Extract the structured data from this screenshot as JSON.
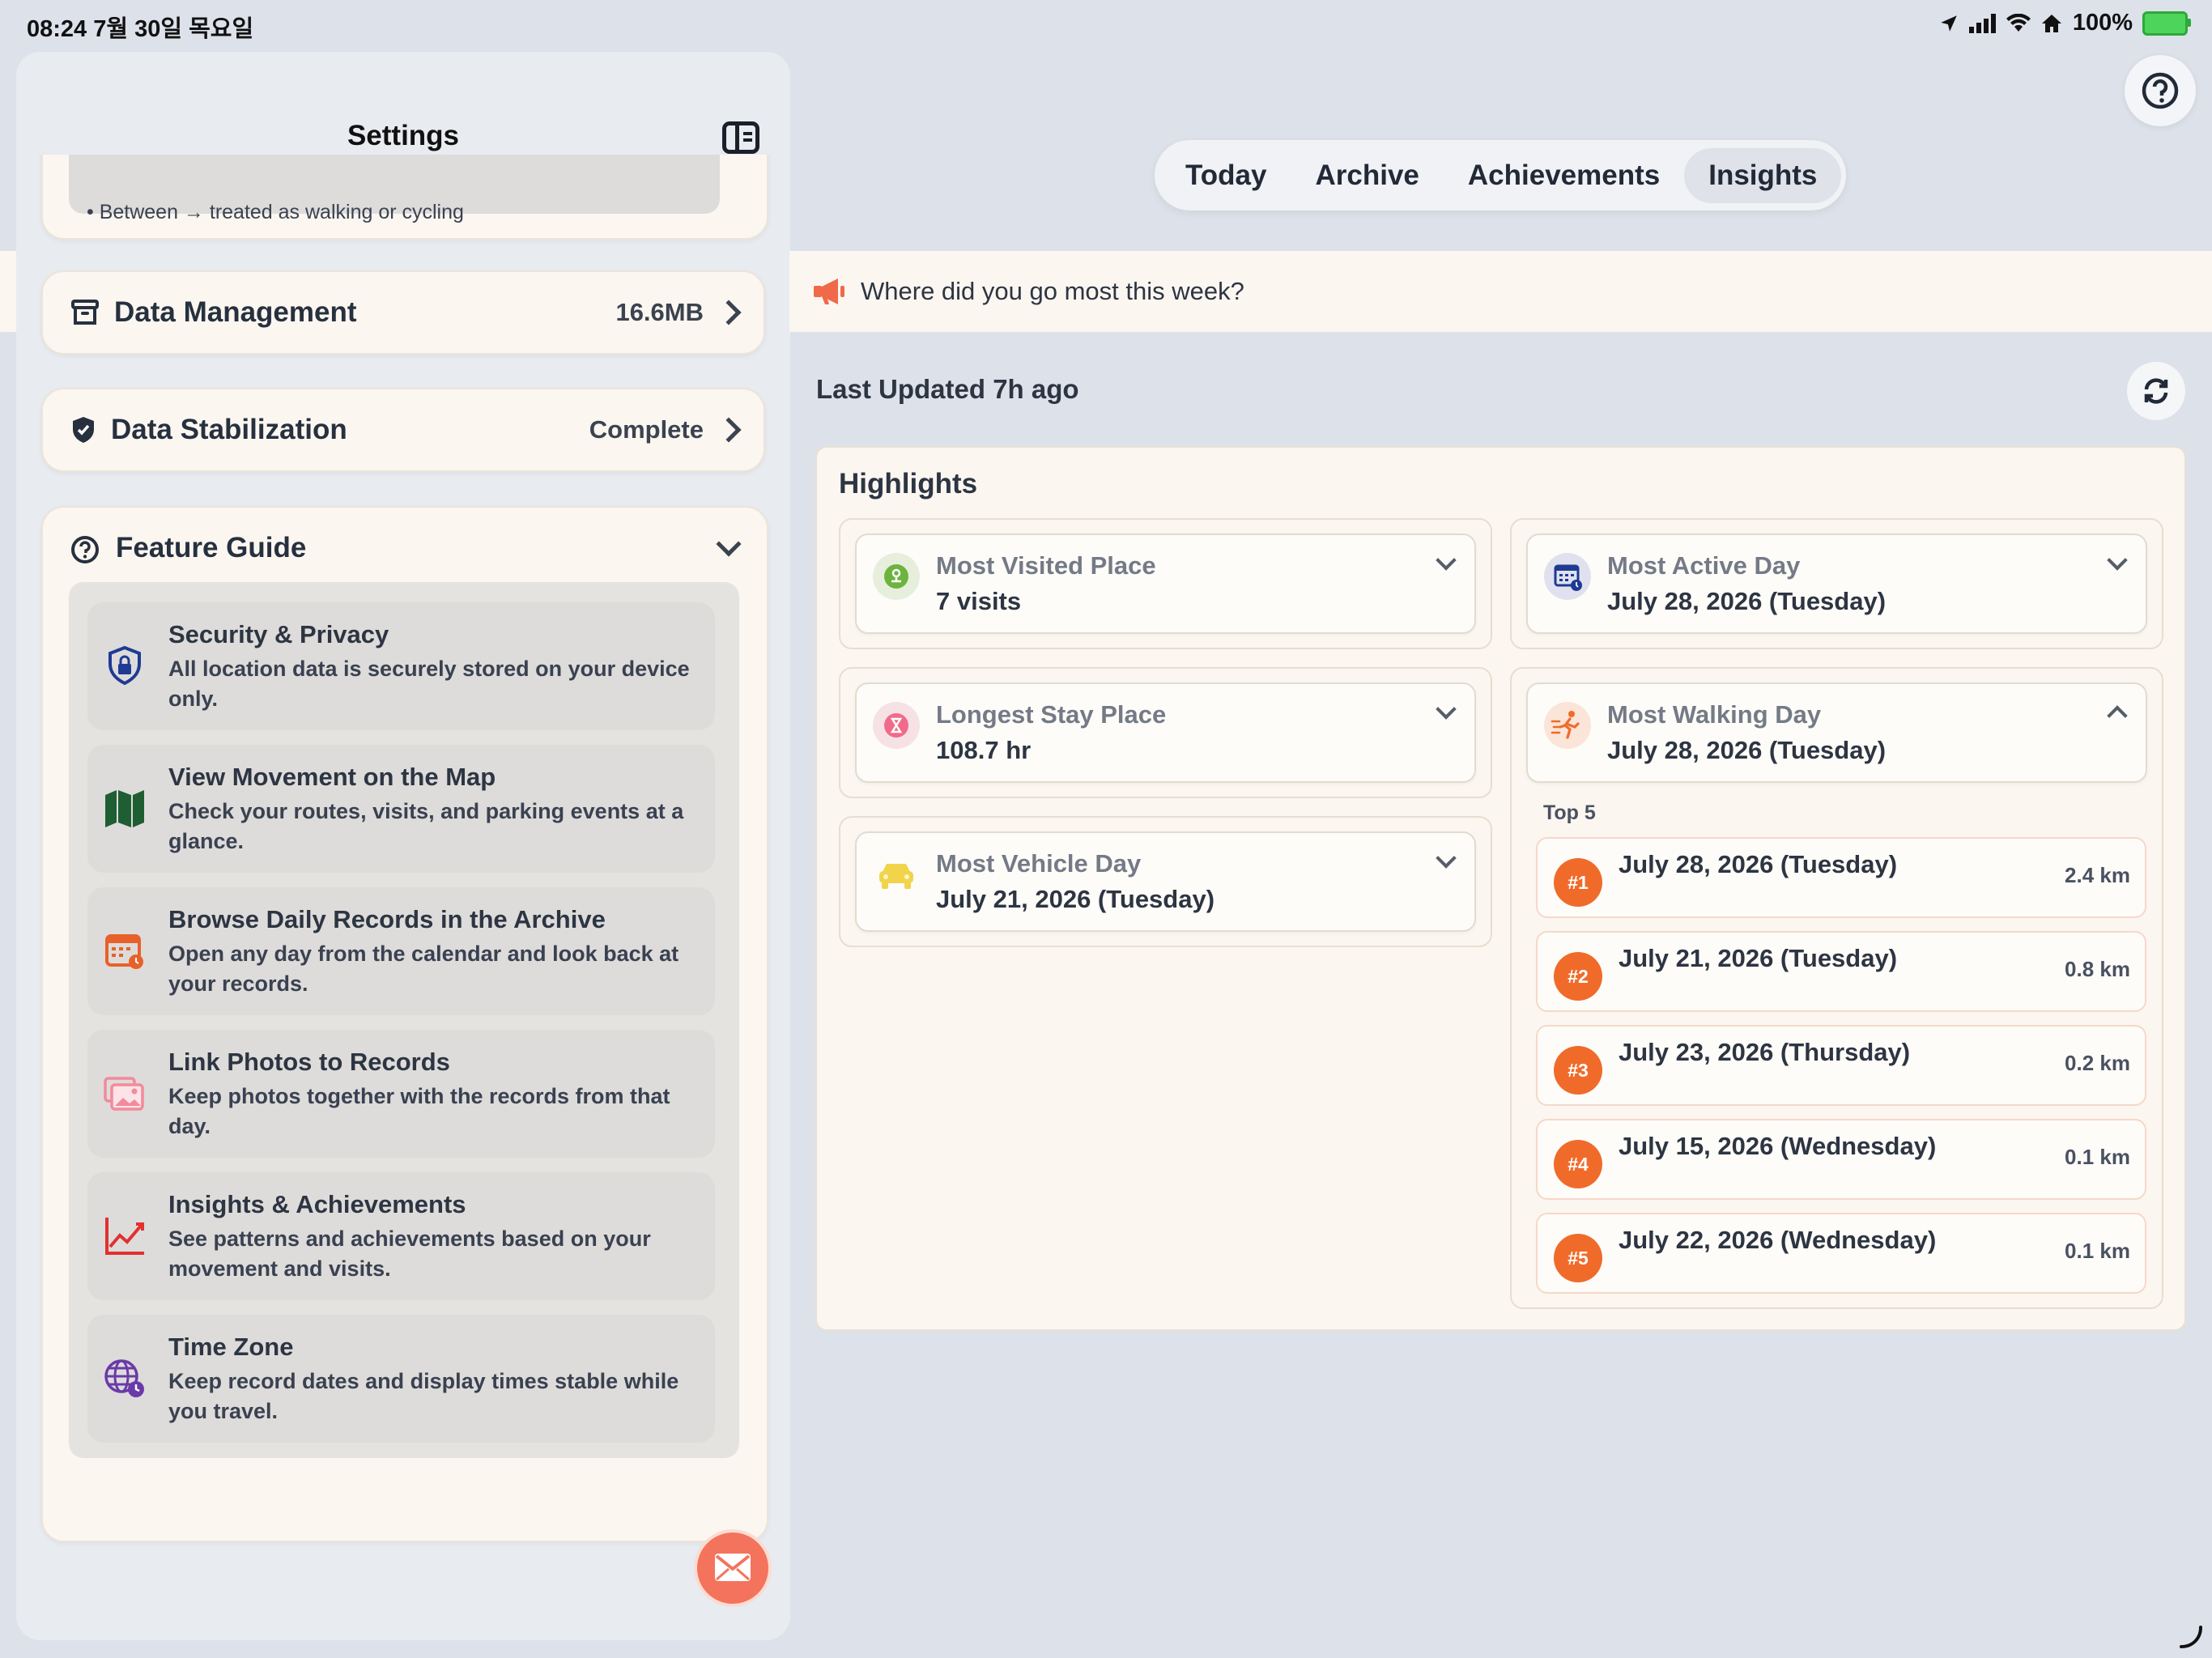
{
  "status_bar": {
    "time_date": "08:24  7월 30일 목요일",
    "battery": "100%"
  },
  "sidebar": {
    "title": "Settings",
    "partial_text": "• Between → treated as walking or cycling",
    "data_management": {
      "label": "Data Management",
      "value": "16.6MB"
    },
    "data_stabilization": {
      "label": "Data Stabilization",
      "value": "Complete"
    },
    "feature_guide": {
      "title": "Feature Guide",
      "items": [
        {
          "title": "Security & Privacy",
          "desc": "All location data is securely stored on your device only.",
          "icon": "lock-shield-icon",
          "color": "#1f3a93"
        },
        {
          "title": "View Movement on the Map",
          "desc": "Check your routes, visits, and parking events at a glance.",
          "icon": "map-icon",
          "color": "#1e5e32"
        },
        {
          "title": "Browse Daily Records in the Archive",
          "desc": "Open any day from the calendar and look back at your records.",
          "icon": "calendar-icon",
          "color": "#e8612a"
        },
        {
          "title": "Link Photos to Records",
          "desc": "Keep photos together with the records from that day.",
          "icon": "photos-icon",
          "color": "#f28a9b"
        },
        {
          "title": "Insights & Achievements",
          "desc": "See patterns and achievements based on your movement and visits.",
          "icon": "chart-line-icon",
          "color": "#e23030"
        },
        {
          "title": "Time Zone",
          "desc": "Keep record dates and display times stable while you travel.",
          "icon": "globe-clock-icon",
          "color": "#6a3aa8"
        }
      ]
    }
  },
  "tabs": [
    "Today",
    "Archive",
    "Achievements",
    "Insights"
  ],
  "active_tab": "Insights",
  "banner": {
    "text": "Where did you go most this week?",
    "icon": "megaphone-icon"
  },
  "last_updated": "Last Updated 7h ago",
  "highlights": {
    "title": "Highlights",
    "cards": [
      {
        "label": "Most Visited Place",
        "value": "7 visits",
        "icon": "location-pin-icon",
        "color": "#6db33f"
      },
      {
        "label": "Longest Stay Place",
        "value": "108.7 hr",
        "icon": "hourglass-icon",
        "color": "#f06b8a"
      },
      {
        "label": "Most Vehicle Day",
        "value": "July 21, 2026 (Tuesday)",
        "icon": "car-icon",
        "color": "#f2d44a"
      },
      {
        "label": "Most Active Day",
        "value": "July 28, 2026 (Tuesday)",
        "icon": "calendar-grid-icon",
        "color": "#1f3a93"
      },
      {
        "label": "Most Walking Day",
        "value": "July 28, 2026 (Tuesday)",
        "icon": "running-icon",
        "color": "#f06a2a"
      }
    ],
    "top5_label": "Top 5",
    "top5": [
      {
        "rank": "#1",
        "date": "July 28, 2026 (Tuesday)",
        "distance": "2.4 km"
      },
      {
        "rank": "#2",
        "date": "July 21, 2026 (Tuesday)",
        "distance": "0.8 km"
      },
      {
        "rank": "#3",
        "date": "July 23, 2026 (Thursday)",
        "distance": "0.2 km"
      },
      {
        "rank": "#4",
        "date": "July 15, 2026 (Wednesday)",
        "distance": "0.1 km"
      },
      {
        "rank": "#5",
        "date": "July 22, 2026 (Wednesday)",
        "distance": "0.1 km"
      }
    ]
  },
  "colors": {
    "accent": "#f06a2a",
    "background": "#dde2ea",
    "card": "#fbf7f0"
  }
}
